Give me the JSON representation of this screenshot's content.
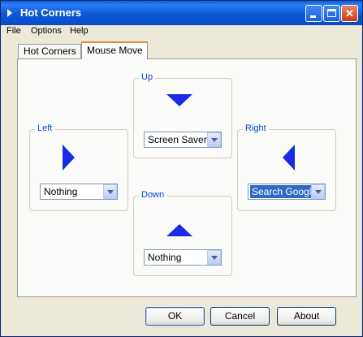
{
  "window": {
    "title": "Hot Corners",
    "colors": {
      "titlebar": "#0a5fd8",
      "accent_tab": "#e68b2c",
      "arrow": "#1a2be8",
      "group_label": "#0046d5"
    }
  },
  "menu": {
    "items": [
      "File",
      "Options",
      "Help"
    ]
  },
  "tabs": [
    {
      "label": "Hot Corners",
      "active": false
    },
    {
      "label": "Mouse Move",
      "active": true
    }
  ],
  "groups": {
    "up": {
      "label": "Up",
      "icon": "arrow-down-icon",
      "selected": "Screen Saver"
    },
    "left": {
      "label": "Left",
      "icon": "arrow-right-icon",
      "selected": "Nothing"
    },
    "right": {
      "label": "Right",
      "icon": "arrow-left-icon",
      "selected": "Search Google"
    },
    "down": {
      "label": "Down",
      "icon": "arrow-up-icon",
      "selected": "Nothing"
    }
  },
  "buttons": {
    "ok": "OK",
    "cancel": "Cancel",
    "about": "About"
  }
}
